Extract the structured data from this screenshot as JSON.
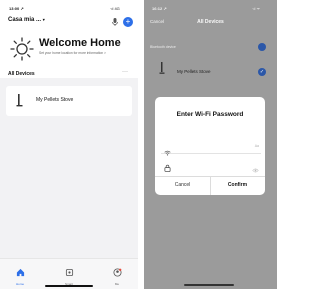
{
  "left": {
    "status": {
      "time": "13:00 ↗",
      "signal": "·ıl 4G"
    },
    "header": {
      "home_name": "Casa mia ..."
    },
    "welcome": {
      "title": "Welcome Home",
      "subtitle": "Set your home location for more information >"
    },
    "devices": {
      "section_label": "All Devices",
      "more": "···",
      "items": [
        {
          "name": "My Pellets Stove"
        }
      ]
    },
    "tabbar": [
      {
        "label": "Home",
        "icon": "home-icon"
      },
      {
        "label": "Smart",
        "icon": "smart-icon"
      },
      {
        "label": "Me",
        "icon": "me-icon"
      }
    ]
  },
  "right": {
    "status": {
      "time": "16:12 ↗",
      "signal": "·ıl ᯤ"
    },
    "nav": {
      "cancel": "Cancel",
      "title": "All Devices"
    },
    "bluetooth_label": "Bluetooth device",
    "device_name": "My Pellets Stove",
    "dialog": {
      "title": "Enter Wi-Fi Password",
      "ssid_hint": "Aa",
      "password_value": "",
      "cancel": "Cancel",
      "confirm": "Confirm"
    }
  },
  "colors": {
    "accent": "#2d6fe8",
    "home_tab": "#2d6fe8",
    "dim_overlay": "#9b9b9b"
  }
}
